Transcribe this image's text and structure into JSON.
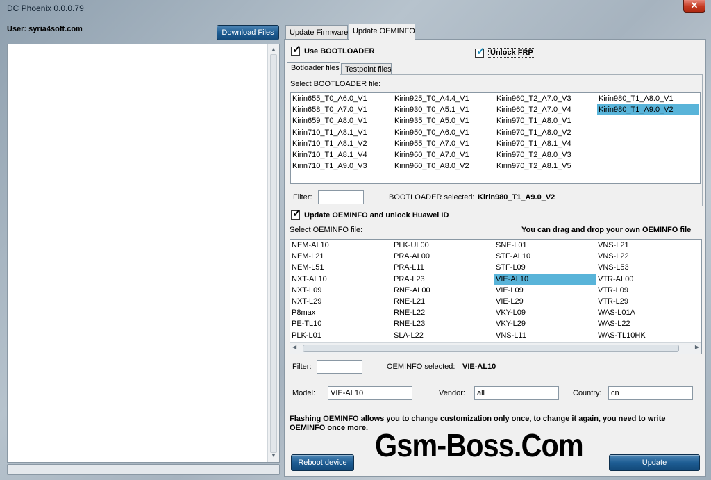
{
  "window": {
    "title": "DC Phoenix 0.0.0.79",
    "close_glyph": "✕"
  },
  "user_label": "User: syria4soft.com",
  "download_button": "Download Files",
  "main_tabs": [
    "Update Firmware",
    "Update OEMINFO"
  ],
  "use_bootloader": {
    "label": "Use BOOTLOADER",
    "checked": true
  },
  "unlock_frp": {
    "label": "Unlock FRP",
    "checked": true
  },
  "sub_tabs": [
    "Botloader files",
    "Testpoint files"
  ],
  "bootloader": {
    "select_label": "Select BOOTLOADER file:",
    "columns": [
      [
        "Kirin655_T0_A6.0_V1",
        "Kirin658_T0_A7.0_V1",
        "Kirin659_T0_A8.0_V1",
        "Kirin710_T1_A8.1_V1",
        "Kirin710_T1_A8.1_V2",
        "Kirin710_T1_A8.1_V4",
        "Kirin710_T1_A9.0_V3"
      ],
      [
        "Kirin925_T0_A4.4_V1",
        "Kirin930_T0_A5.1_V1",
        "Kirin935_T0_A5.0_V1",
        "Kirin950_T0_A6.0_V1",
        "Kirin955_T0_A7.0_V1",
        "Kirin960_T0_A7.0_V1",
        "Kirin960_T0_A8.0_V2"
      ],
      [
        "Kirin960_T2_A7.0_V3",
        "Kirin960_T2_A7.0_V4",
        "Kirin970_T1_A8.0_V1",
        "Kirin970_T1_A8.0_V2",
        "Kirin970_T1_A8.1_V4",
        "Kirin970_T2_A8.0_V3",
        "Kirin970_T2_A8.1_V5"
      ],
      [
        "Kirin980_T1_A8.0_V1",
        "Kirin980_T1_A9.0_V2"
      ]
    ],
    "selected": "Kirin980_T1_A9.0_V2",
    "filter_label": "Filter:",
    "filter_value": "",
    "selected_label": "BOOTLOADER selected:",
    "selected_value": "Kirin980_T1_A9.0_V2"
  },
  "update_oeminfo": {
    "label": "Update OEMINFO and unlock Huawei ID",
    "checked": true
  },
  "oeminfo": {
    "select_label": "Select OEMINFO file:",
    "drag_hint": "You can drag and drop your own OEMINFO file",
    "columns": [
      [
        "NEM-AL10",
        "NEM-L21",
        "NEM-L51",
        "NXT-AL10",
        "NXT-L09",
        "NXT-L29",
        "P8max",
        "PE-TL10",
        "PLK-L01"
      ],
      [
        "PLK-UL00",
        "PRA-AL00",
        "PRA-L11",
        "PRA-L23",
        "RNE-AL00",
        "RNE-L21",
        "RNE-L22",
        "RNE-L23",
        "SLA-L22"
      ],
      [
        "SNE-L01",
        "STF-AL10",
        "STF-L09",
        "VIE-AL10",
        "VIE-L09",
        "VIE-L29",
        "VKY-L09",
        "VKY-L29",
        "VNS-L11"
      ],
      [
        "VNS-L21",
        "VNS-L22",
        "VNS-L53",
        "VTR-AL00",
        "VTR-L09",
        "VTR-L29",
        "WAS-L01A",
        "WAS-L22",
        "WAS-TL10HK"
      ]
    ],
    "selected": "VIE-AL10",
    "filter_label": "Filter:",
    "filter_value": "",
    "selected_label": "OEMINFO selected:",
    "selected_value": "VIE-AL10"
  },
  "fields": {
    "model_label": "Model:",
    "model_value": "VIE-AL10",
    "vendor_label": "Vendor:",
    "vendor_value": "all",
    "country_label": "Country:",
    "country_value": "cn"
  },
  "info_text": "Flashing OEMINFO allows you to change customization only once, to change it again, you need to write OEMINFO once more.",
  "reboot_button": "Reboot device",
  "update_button": "Update",
  "watermark": "Gsm-Boss.Com",
  "colors": {
    "selection": "#59b4d9",
    "button": "#1e5d93",
    "close": "#c43a22"
  }
}
